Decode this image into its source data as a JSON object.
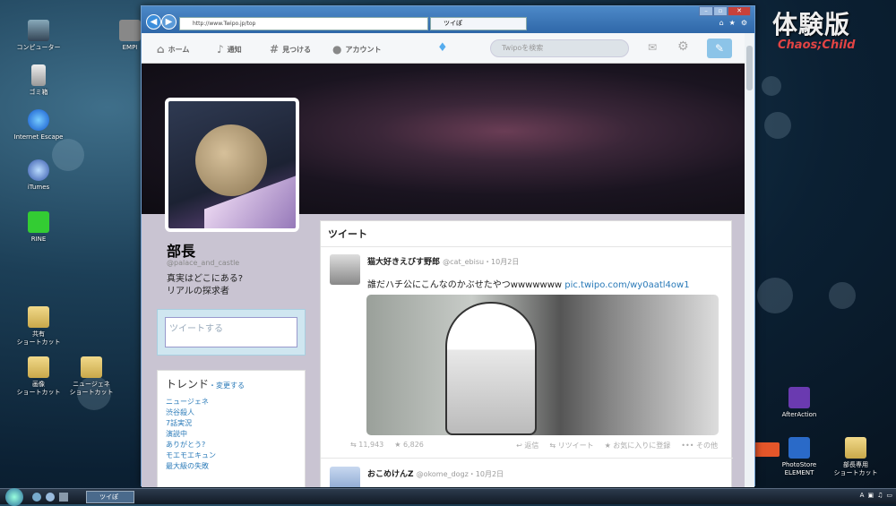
{
  "desktop": {
    "icons": [
      {
        "label": "コンピューター"
      },
      {
        "label": "ゴミ箱"
      },
      {
        "label": "Internet Escape"
      },
      {
        "label": "iTumes"
      },
      {
        "label": "RINE"
      },
      {
        "label": "共有\nショートカット"
      },
      {
        "label": "画像\nショートカット"
      },
      {
        "label": "ニュージェネ\nショートカット"
      },
      {
        "label": "AfterAction"
      },
      {
        "label": "PhotoStore\nELEMENT"
      },
      {
        "label": "部長専用\nショートカット"
      },
      {
        "label": "EMPI"
      }
    ]
  },
  "logo": {
    "title": "体験版",
    "subtitle": "Chaos;Child"
  },
  "browser": {
    "address": "http://www.Twipo.jp/top",
    "tab_title": "ツイぽ",
    "taskbar_item": "ツイぽ"
  },
  "twipo": {
    "nav": {
      "home": "ホーム",
      "notify": "通知",
      "discover": "見つける",
      "account": "アカウント"
    },
    "search_placeholder": "Twipoを検索",
    "profile": {
      "name": "部長",
      "handle": "@palace_and_castle",
      "bio1": "真実はどこにある?",
      "bio2": "リアルの探求者"
    },
    "compose_placeholder": "ツイートする",
    "trends": {
      "title": "トレンド",
      "change": "・変更する",
      "items": [
        "ニュージェネ",
        "渋谷殺人",
        "7話実況",
        "演説中",
        "ありがとう?",
        "モエモエキュン",
        "最大級の失敗"
      ]
    },
    "stream_title": "ツイート",
    "tweets": [
      {
        "name": "猫大好きえびす野郎",
        "handle": "@cat_ebisu",
        "date": "・10月2日",
        "text": "誰だハチ公にこんなのかぶせたやつwwwwwww",
        "link": "pic.twipo.com/wy0aatl4ow1",
        "retweets": "11,943",
        "favorites": "6,826",
        "reply": "返信",
        "retweet": "リツイート",
        "fav": "お気に入りに登録",
        "more": "その他"
      },
      {
        "name": "おこめけんZ",
        "handle": "@okome_dogz",
        "date": "・10月2日"
      }
    ]
  }
}
